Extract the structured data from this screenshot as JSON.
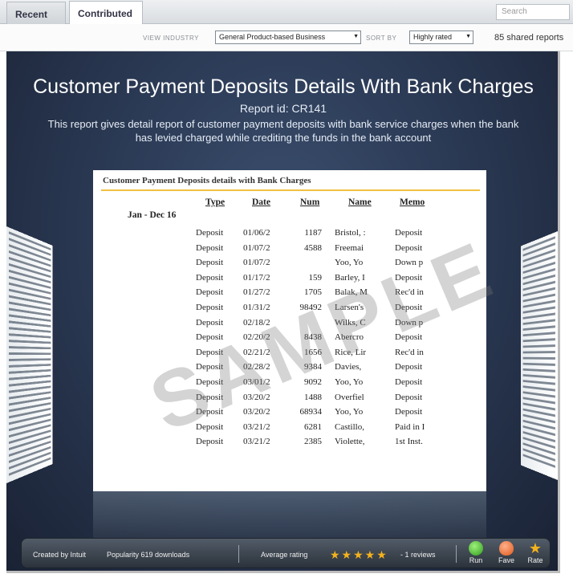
{
  "tabs": {
    "recent": "Recent",
    "contributed": "Contributed"
  },
  "search": {
    "placeholder": "Search"
  },
  "filters": {
    "industry_label": "VIEW INDUSTRY",
    "industry_value": "General Product-based Business",
    "sort_label": "SORT BY",
    "sort_value": "Highly rated",
    "shared_count": "85 shared reports"
  },
  "report": {
    "title": "Customer Payment Deposits Details With Bank Charges",
    "report_id": "Report id: CR141",
    "description": "This report gives detail report of customer payment deposits with bank service charges when the bank has levied charged while crediting the funds in the bank account"
  },
  "sheet": {
    "heading": "Customer Payment Deposits details with Bank Charges",
    "columns": [
      "Type",
      "Date",
      "Num",
      "Name",
      "Memo"
    ],
    "period": "Jan - Dec 16",
    "watermark": "SAMPLE",
    "rows": [
      [
        "Deposit",
        "01/06/2",
        "1187",
        "Bristol, :",
        "Deposit"
      ],
      [
        "Deposit",
        "01/07/2",
        "4588",
        "Freemai",
        "Deposit"
      ],
      [
        "Deposit",
        "01/07/2",
        "",
        "Yoo, Yo",
        "Down p"
      ],
      [
        "Deposit",
        "01/17/2",
        "159",
        "Barley, I",
        "Deposit"
      ],
      [
        "Deposit",
        "01/27/2",
        "1705",
        "Balak, M",
        "Rec'd in"
      ],
      [
        "Deposit",
        "01/31/2",
        "98492",
        "Larsen's",
        "Deposit"
      ],
      [
        "Deposit",
        "02/18/2",
        "",
        "Wilks, C",
        "Down p"
      ],
      [
        "Deposit",
        "02/20/2",
        "8438",
        "Abercro",
        "Deposit"
      ],
      [
        "Deposit",
        "02/21/2",
        "1656",
        "Rice, Lir",
        "Rec'd in"
      ],
      [
        "Deposit",
        "02/28/2",
        "9384",
        "Davies,",
        "Deposit"
      ],
      [
        "Deposit",
        "03/01/2",
        "9092",
        "Yoo, Yo",
        "Deposit"
      ],
      [
        "Deposit",
        "03/20/2",
        "1488",
        "Overfiel",
        "Deposit"
      ],
      [
        "Deposit",
        "03/20/2",
        "68934",
        "Yoo, Yo",
        "Deposit"
      ],
      [
        "Deposit",
        "03/21/2",
        "6281",
        "Castillo,",
        "Paid in I"
      ],
      [
        "Deposit",
        "03/21/2",
        "2385",
        "Violette,",
        "1st Inst."
      ]
    ]
  },
  "footer": {
    "created_by": "Created by  Intuit",
    "popularity": "Popularity  619 downloads",
    "avg_rating": "Average rating",
    "stars": "★★★★★",
    "reviews": "- 1 reviews",
    "run": "Run",
    "fave": "Fave",
    "rate": "Rate"
  }
}
